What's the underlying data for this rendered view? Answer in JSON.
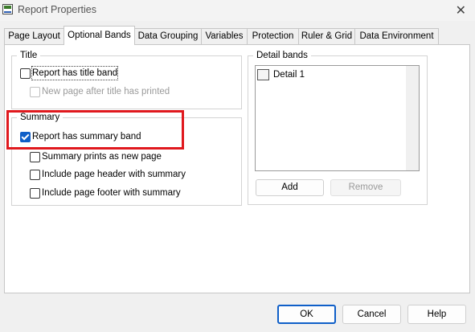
{
  "window": {
    "title": "Report Properties"
  },
  "tabs": [
    {
      "label": "Page Layout"
    },
    {
      "label": "Optional Bands"
    },
    {
      "label": "Data Grouping"
    },
    {
      "label": "Variables"
    },
    {
      "label": "Protection"
    },
    {
      "label": "Ruler & Grid"
    },
    {
      "label": "Data Environment"
    }
  ],
  "active_tab": "Optional Bands",
  "title_group": {
    "legend": "Title",
    "report_has_title_band": {
      "label": "Report has title band",
      "checked": false
    },
    "new_page_after_title": {
      "label": "New page after title has printed",
      "checked": false,
      "disabled": true
    }
  },
  "summary_group": {
    "legend": "Summary",
    "report_has_summary_band": {
      "label": "Report has summary band",
      "checked": true
    },
    "summary_prints_new_page": {
      "label": "Summary prints as new page",
      "checked": false
    },
    "include_header": {
      "label": "Include page header with summary",
      "checked": false
    },
    "include_footer": {
      "label": "Include page footer with summary",
      "checked": false
    }
  },
  "detail_bands": {
    "legend": "Detail bands",
    "items": [
      {
        "label": "Detail 1"
      }
    ],
    "add_label": "Add",
    "remove_label": "Remove"
  },
  "footer": {
    "ok_label": "OK",
    "cancel_label": "Cancel",
    "help_label": "Help"
  },
  "colors": {
    "accent": "#0f5fc8",
    "highlight_box": "#e0191e",
    "dialog_bg": "#f0f0f0"
  },
  "icons": {
    "close": "close-icon",
    "app": "report-app-icon"
  }
}
